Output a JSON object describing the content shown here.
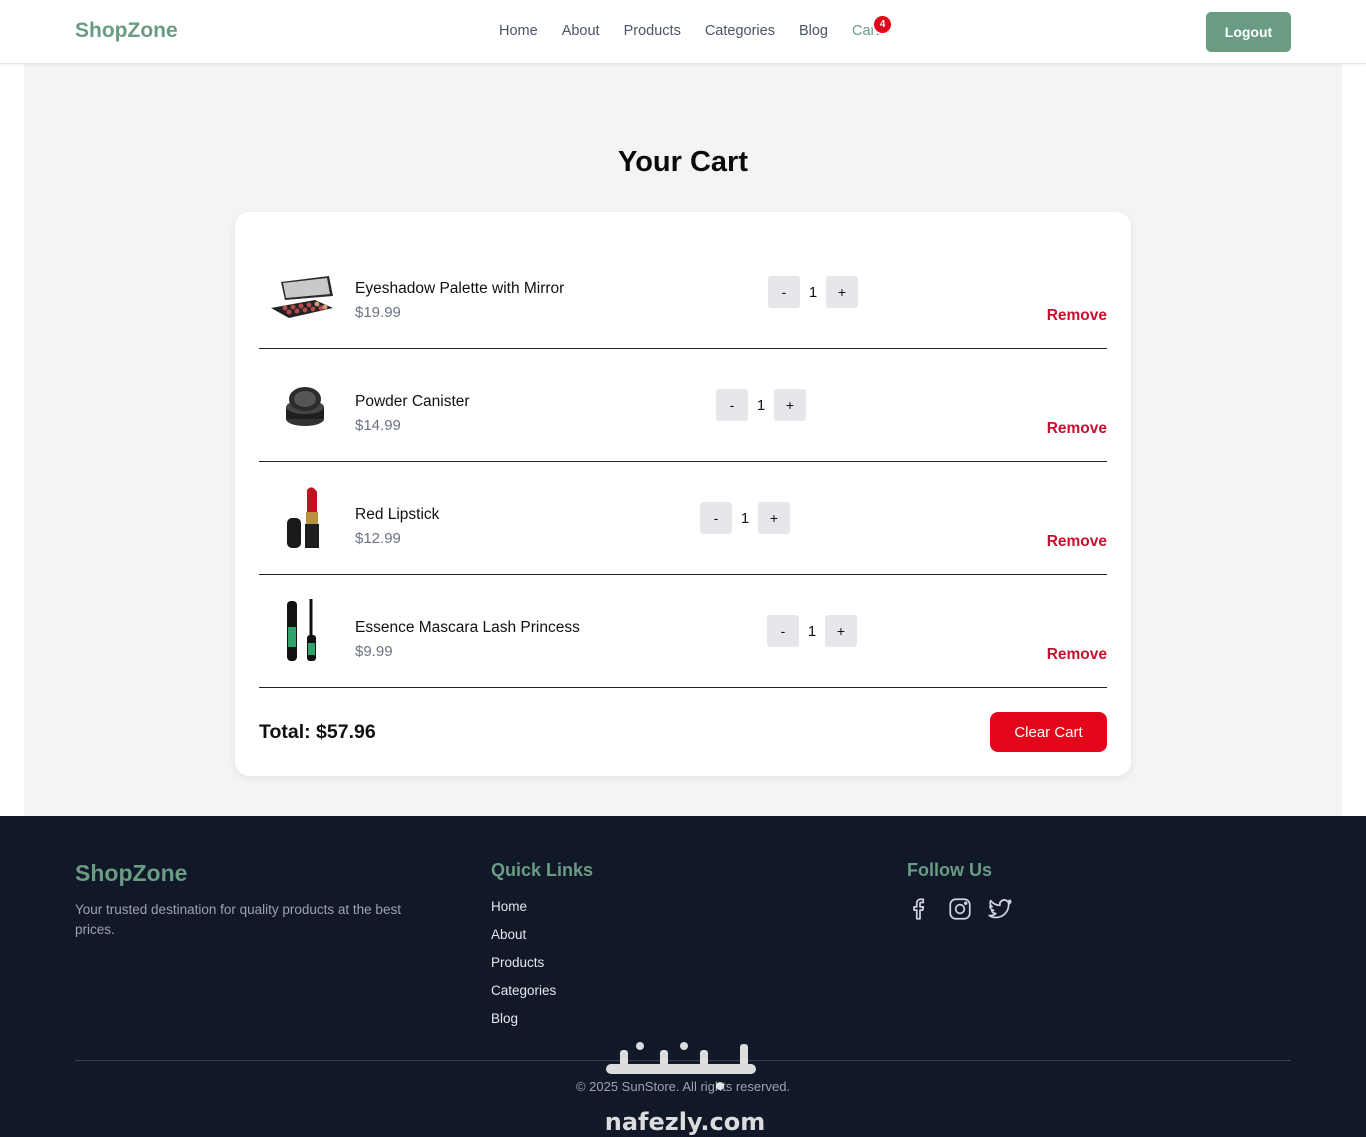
{
  "header": {
    "brand": "ShopZone",
    "nav": [
      "Home",
      "About",
      "Products",
      "Categories",
      "Blog"
    ],
    "cart_label": "Cart",
    "cart_count": "4",
    "logout": "Logout"
  },
  "main": {
    "title": "Your Cart",
    "items": [
      {
        "name": "Eyeshadow Palette with Mirror",
        "price": "$19.99",
        "qty": "1",
        "remove": "Remove",
        "icon": "eyeshadow-palette-image"
      },
      {
        "name": "Powder Canister",
        "price": "$14.99",
        "qty": "1",
        "remove": "Remove",
        "icon": "powder-canister-image"
      },
      {
        "name": "Red Lipstick",
        "price": "$12.99",
        "qty": "1",
        "remove": "Remove",
        "icon": "lipstick-image"
      },
      {
        "name": "Essence Mascara Lash Princess",
        "price": "$9.99",
        "qty": "1",
        "remove": "Remove",
        "icon": "mascara-image"
      }
    ],
    "minus": "-",
    "plus": "+",
    "total": "Total: $57.96",
    "clear": "Clear Cart"
  },
  "footer": {
    "brand": "ShopZone",
    "tagline": "Your trusted destination for quality products at the best prices.",
    "quick_links_title": "Quick Links",
    "links": [
      "Home",
      "About",
      "Products",
      "Categories",
      "Blog"
    ],
    "follow_title": "Follow Us",
    "socials": [
      "facebook-icon",
      "instagram-icon",
      "twitter-icon"
    ],
    "copyright": "© 2025 SunStore. All rights reserved."
  },
  "colors": {
    "brand": "#6a9b83",
    "danger": "#e3061a",
    "remove": "#c8102e",
    "footer_bg": "#111827"
  }
}
